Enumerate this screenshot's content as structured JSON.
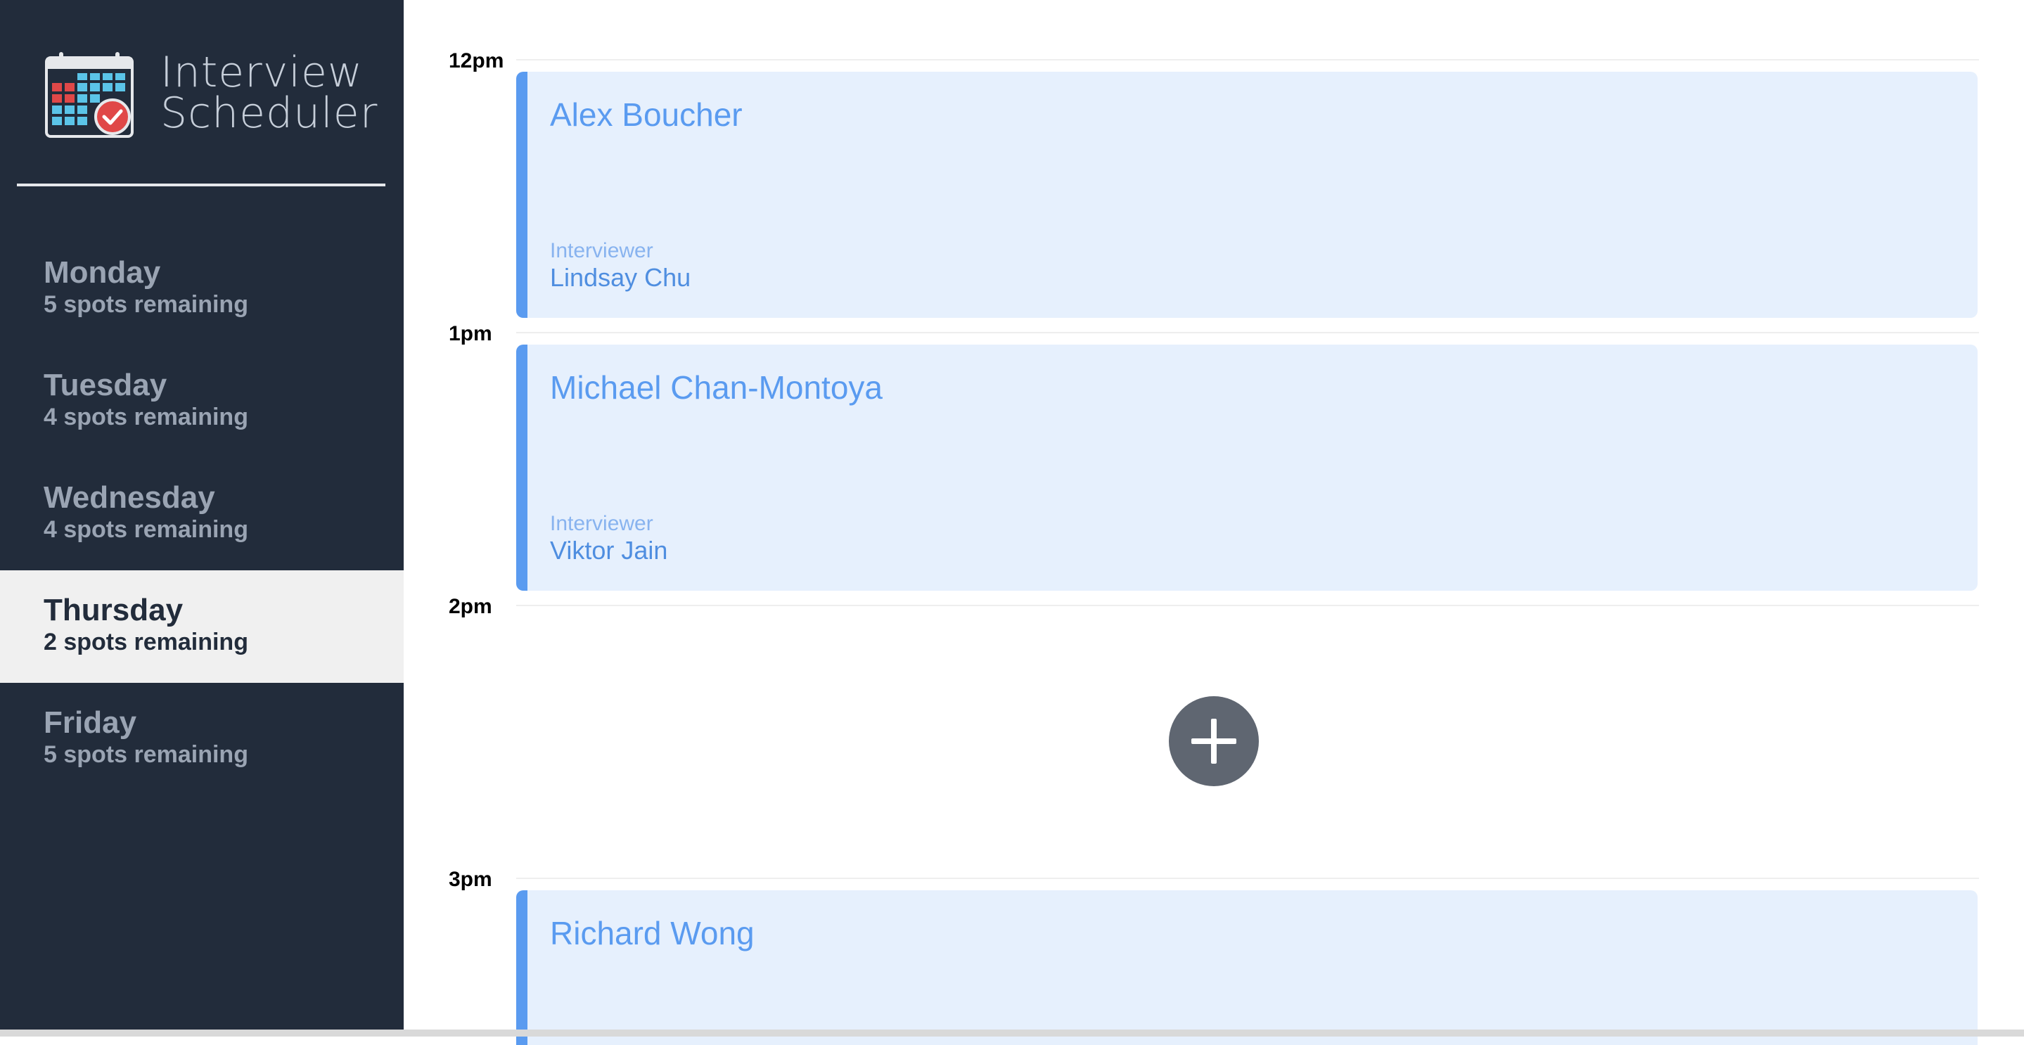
{
  "brand": {
    "line1": "Interview",
    "line2": "Scheduler"
  },
  "days": [
    {
      "name": "Monday",
      "spots": "5 spots remaining",
      "selected": false
    },
    {
      "name": "Tuesday",
      "spots": "4 spots remaining",
      "selected": false
    },
    {
      "name": "Wednesday",
      "spots": "4 spots remaining",
      "selected": false
    },
    {
      "name": "Thursday",
      "spots": "2 spots remaining",
      "selected": true
    },
    {
      "name": "Friday",
      "spots": "5 spots remaining",
      "selected": false
    }
  ],
  "hours": [
    "12pm",
    "1pm",
    "2pm",
    "3pm"
  ],
  "appointments": [
    {
      "student": "Alex Boucher",
      "interviewer_label": "Interviewer",
      "interviewer": "Lindsay Chu"
    },
    {
      "student": "Michael Chan-Montoya",
      "interviewer_label": "Interviewer",
      "interviewer": "Viktor Jain"
    },
    {
      "student": "Richard Wong",
      "interviewer_label": "",
      "interviewer": ""
    }
  ],
  "icons": {
    "logo": "calendar-check-icon",
    "add": "plus-icon"
  },
  "colors": {
    "sidebar": "#222c3b",
    "accent": "#5a9bf0",
    "appointment_bg": "#e6f0fd",
    "selected_day_bg": "#f0f0f0",
    "add_button": "#5f6671",
    "logo_check": "#e04848"
  }
}
